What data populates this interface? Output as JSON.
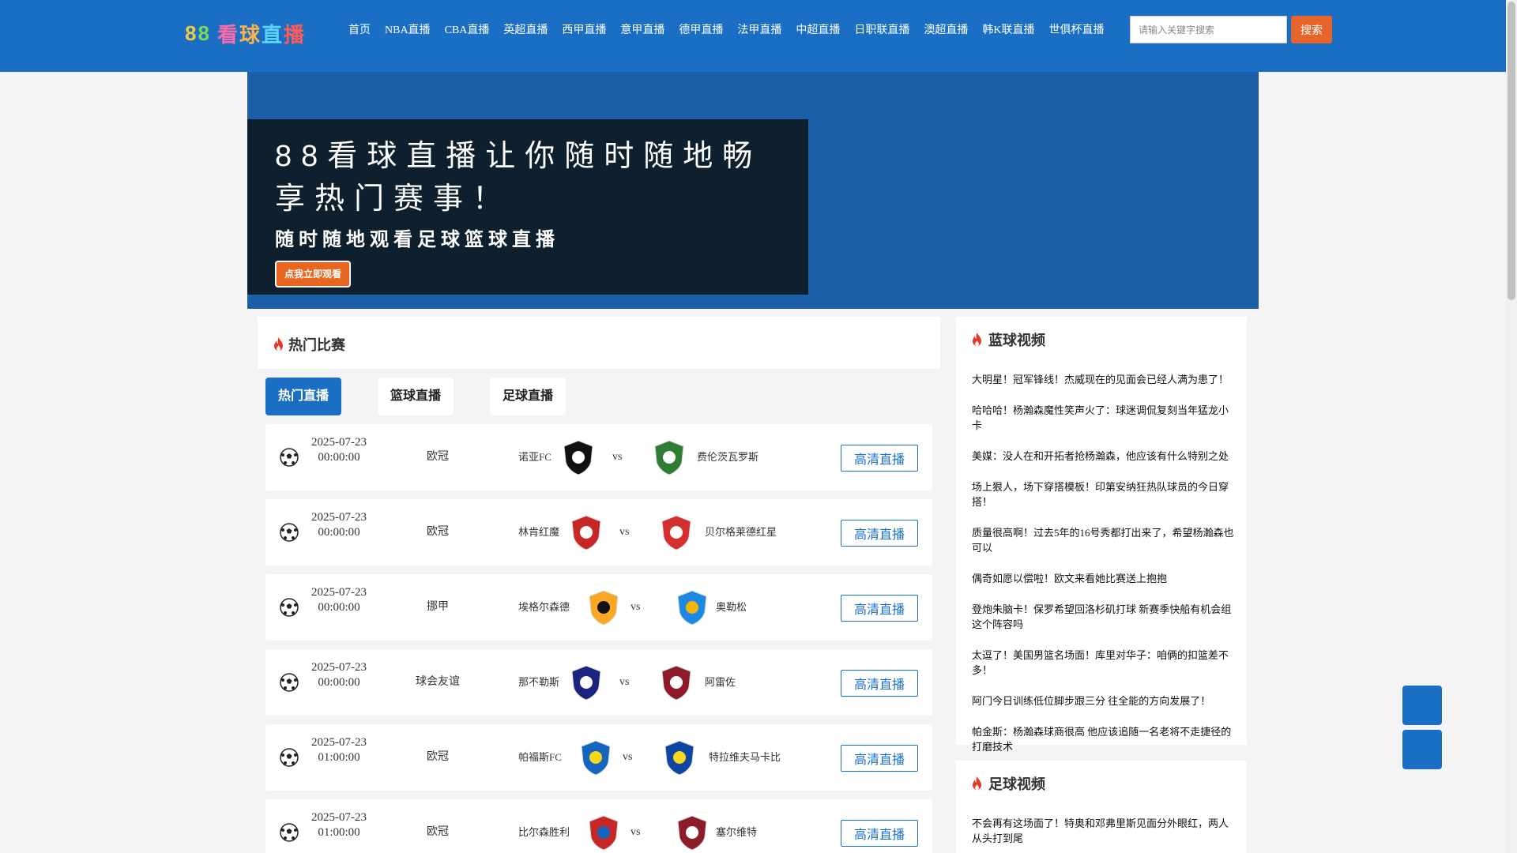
{
  "header": {
    "logo_text": "88看球直播",
    "nav": [
      "首页",
      "NBA直播",
      "CBA直播",
      "英超直播",
      "西甲直播",
      "意甲直播",
      "德甲直播",
      "法甲直播",
      "中超直播",
      "日职联直播",
      "澳超直播",
      "韩K联直播",
      "世俱杯直播"
    ],
    "search_placeholder": "请输入关键字搜索",
    "search_button": "搜索"
  },
  "banner": {
    "title": "88看球直播让你随时随地畅享热门赛事！",
    "subtitle": "随时随地观看足球篮球直播",
    "cta": "点我立即观看"
  },
  "hot": {
    "title": "热门比赛",
    "tabs": [
      "热门直播",
      "篮球直播",
      "足球直播"
    ],
    "watch_label": "高清直播",
    "vs_label": "vs",
    "matches": [
      {
        "date": "2025-07-23",
        "time": "00:00:00",
        "league": "欧冠",
        "home": "诺亚FC",
        "away": "费伦茨瓦罗斯"
      },
      {
        "date": "2025-07-23",
        "time": "00:00:00",
        "league": "欧冠",
        "home": "林肯红魔",
        "away": "贝尔格莱德红星"
      },
      {
        "date": "2025-07-23",
        "time": "00:00:00",
        "league": "挪甲",
        "home": "埃格尔森德",
        "away": "奥勒松"
      },
      {
        "date": "2025-07-23",
        "time": "00:00:00",
        "league": "球会友谊",
        "home": "那不勒斯",
        "away": "阿雷佐"
      },
      {
        "date": "2025-07-23",
        "time": "01:00:00",
        "league": "欧冠",
        "home": "帕福斯FC",
        "away": "特拉维夫马卡比"
      },
      {
        "date": "2025-07-23",
        "time": "01:00:00",
        "league": "欧冠",
        "home": "比尔森胜利",
        "away": "塞尔维特"
      }
    ]
  },
  "basketball": {
    "title": "蓝球视频",
    "items": [
      "大明星！冠军锋线！杰威现在的见面会已经人满为患了！",
      "哈哈哈！杨瀚森魔性笑声火了：球迷调侃复刻当年猛龙小卡",
      "美媒：没人在和开拓者抢杨瀚森，他应该有什么特别之处",
      "场上狠人，场下穿搭模板！印第安纳狂热队球员的今日穿搭！",
      "质量很高啊！过去5年的16号秀都打出来了，希望杨瀚森也可以",
      "偶奇如愿以偿啦！欧文来看她比赛送上抱抱",
      "登炮朱脑卡！保罗希望回洛杉矶打球 新赛季快船有机会组这个阵容吗",
      "太逗了！美国男篮名场面！库里对华子：咱俩的扣篮差不多！",
      "阿门今日训练低位脚步跟三分 往全能的方向发展了！",
      "帕金斯：杨瀚森球商很高 他应该追随一名老将不走捷径的打磨技术"
    ]
  },
  "football": {
    "title": "足球视频",
    "items": [
      "不会再有这场面了！特奥和邓弗里斯见面分外眼红，两人从头打到尾"
    ]
  },
  "colors": {
    "primary": "#1a6fc4",
    "accent": "#e5652a",
    "banner_card": "#0e1f2e"
  }
}
